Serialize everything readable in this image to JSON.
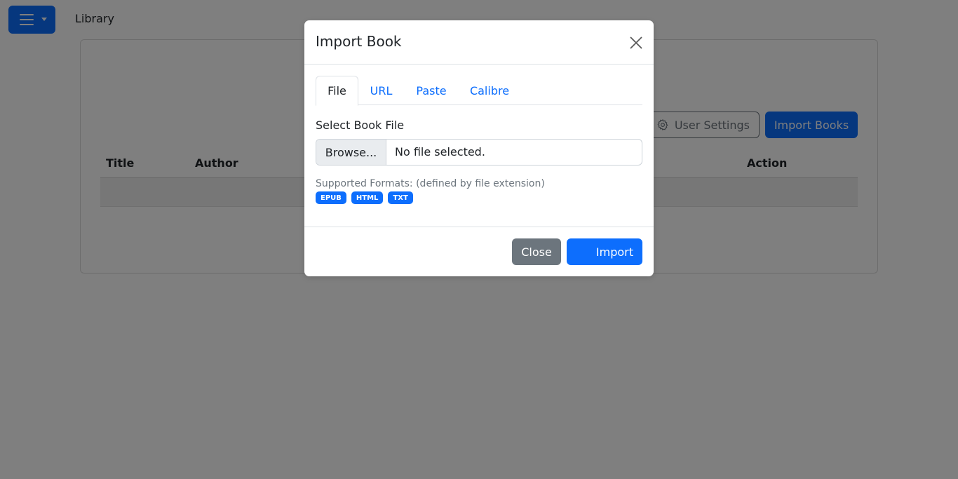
{
  "navbar": {
    "title": "Library",
    "menu_icon": "hamburger-menu-icon"
  },
  "page": {
    "user_settings_label": "User Settings",
    "import_books_label": "Import Books",
    "table_headers": {
      "title": "Title",
      "author": "Author",
      "action": "Action"
    }
  },
  "modal": {
    "title": "Import Book",
    "tabs": [
      {
        "label": "File",
        "active": true
      },
      {
        "label": "URL",
        "active": false
      },
      {
        "label": "Paste",
        "active": false
      },
      {
        "label": "Calibre",
        "active": false
      }
    ],
    "field_label": "Select Book File",
    "browse_label": "Browse...",
    "file_status": "No file selected.",
    "formats_text": "Supported Formats: (defined by file extension)",
    "formats": [
      "EPUB",
      "HTML",
      "TXT"
    ],
    "close_label": "Close",
    "import_label": "Import"
  },
  "colors": {
    "primary": "#0d6efd",
    "secondary": "#6c757d",
    "backdrop": "rgba(0,0,0,0.5)"
  }
}
